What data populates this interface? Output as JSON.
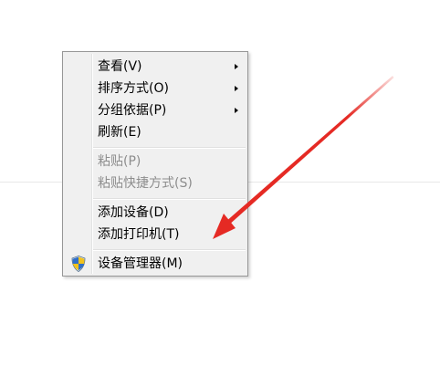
{
  "context_menu": {
    "items": [
      {
        "label": "查看(V)",
        "submenu": true,
        "disabled": false
      },
      {
        "label": "排序方式(O)",
        "submenu": true,
        "disabled": false
      },
      {
        "label": "分组依据(P)",
        "submenu": true,
        "disabled": false
      },
      {
        "label": "刷新(E)",
        "submenu": false,
        "disabled": false
      },
      {
        "label": "粘贴(P)",
        "submenu": false,
        "disabled": true
      },
      {
        "label": "粘贴快捷方式(S)",
        "submenu": false,
        "disabled": true
      },
      {
        "label": "添加设备(D)",
        "submenu": false,
        "disabled": false
      },
      {
        "label": "添加打印机(T)",
        "submenu": false,
        "disabled": false
      },
      {
        "label": "设备管理器(M)",
        "submenu": false,
        "disabled": false,
        "icon": "uac-shield-icon"
      }
    ]
  },
  "annotation": {
    "color": "#e52a24",
    "icon": "red-arrow"
  },
  "colors": {
    "menu_bg": "#f0f0f0",
    "menu_border": "#979797",
    "disabled_text": "#8d8d8d"
  }
}
